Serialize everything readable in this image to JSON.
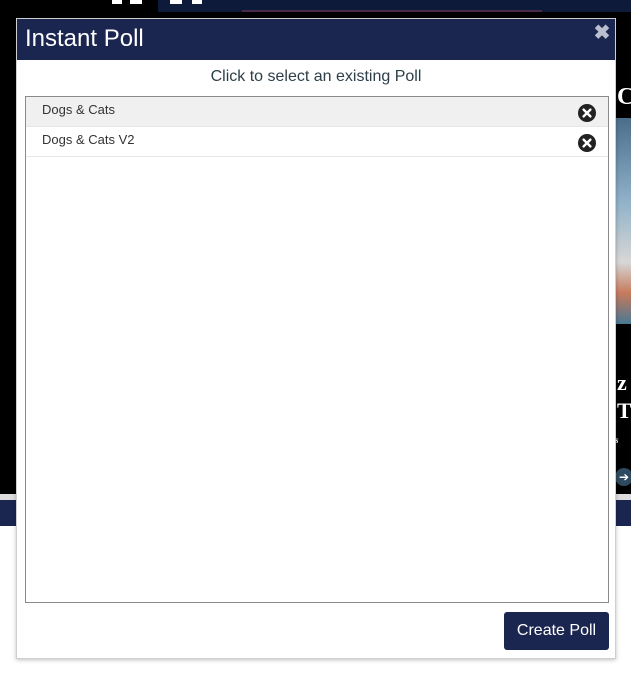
{
  "modal": {
    "title": "Instant Poll",
    "close_icon": "close-icon",
    "subtitle": "Click to select an existing Poll",
    "polls": [
      {
        "name": "Dogs & Cats",
        "selected": true,
        "delete_icon": "delete-circle-x-icon"
      },
      {
        "name": "Dogs & Cats V2",
        "selected": false,
        "delete_icon": "delete-circle-x-icon"
      }
    ],
    "create_button_label": "Create Poll"
  },
  "colors": {
    "header_bg": "#1b2650",
    "button_bg": "#1b2650",
    "selected_row_bg": "#f0f0f0"
  }
}
